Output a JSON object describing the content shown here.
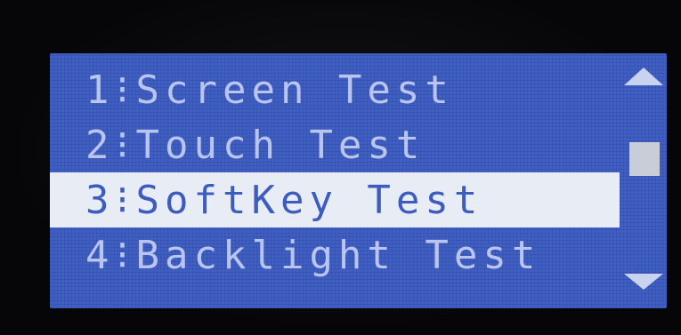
{
  "menu": {
    "items": [
      {
        "number": "1",
        "separator": "⁝",
        "label": "Screen Test"
      },
      {
        "number": "2",
        "separator": "⁝",
        "label": "Touch Test"
      },
      {
        "number": "3",
        "separator": "⁝",
        "label": "SoftKey Test"
      },
      {
        "number": "4",
        "separator": "⁝",
        "label": "Backlight Test"
      }
    ],
    "selected_index": 2
  },
  "scrollbar": {
    "up_icon": "triangle-up-icon",
    "down_icon": "triangle-down-icon",
    "position_fraction": 0.3
  },
  "colors": {
    "screen_background": "#3f5fc4",
    "text": "#b9c5ee",
    "highlight_background": "#e8ecf4",
    "highlight_text": "#3c5cc0"
  }
}
